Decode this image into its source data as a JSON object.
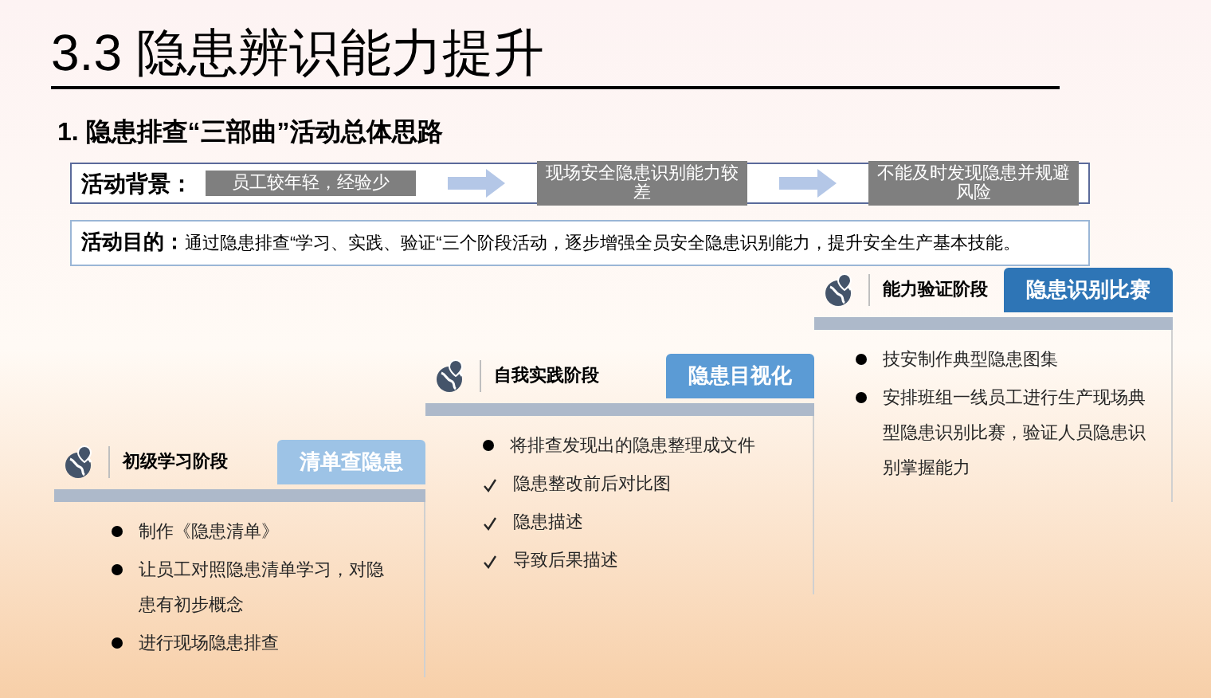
{
  "title": "3.3 隐患辨识能力提升",
  "heading": "1. 隐患排查“三部曲”活动总体思路",
  "background": {
    "label": "活动背景：",
    "steps": [
      "员工较年轻，经验少",
      "现场安全隐患识别能力较差",
      "不能及时发现隐患并规避风险"
    ]
  },
  "purpose": {
    "label": "活动目的：",
    "text": "通过隐患排查“学习、实践、验证“三个阶段活动，逐步增强全员安全隐患识别能力，提升安全生产基本技能。"
  },
  "stages": [
    {
      "name": "初级学习阶段",
      "badge": "清单查隐患",
      "color": "#9dc3e6",
      "items": [
        {
          "kind": "bullet",
          "text": "制作《隐患清单》"
        },
        {
          "kind": "bullet",
          "text": "让员工对照隐患清单学习，对隐患有初步概念"
        },
        {
          "kind": "bullet",
          "text": "进行现场隐患排查"
        }
      ]
    },
    {
      "name": "自我实践阶段",
      "badge": "隐患目视化",
      "color": "#5b9bd5",
      "items": [
        {
          "kind": "bullet",
          "text": "将排查发现出的隐患整理成文件"
        },
        {
          "kind": "check",
          "text": "隐患整改前后对比图"
        },
        {
          "kind": "check",
          "text": "隐患描述"
        },
        {
          "kind": "check",
          "text": "导致后果描述"
        }
      ]
    },
    {
      "name": "能力验证阶段",
      "badge": "隐患识别比赛",
      "color": "#2e75b6",
      "items": [
        {
          "kind": "bullet",
          "text": "技安制作典型隐患图集"
        },
        {
          "kind": "bullet",
          "text": "安排班组一线员工进行生产现场典型隐患识别比赛，验证人员隐患识别掌握能力"
        }
      ]
    }
  ]
}
